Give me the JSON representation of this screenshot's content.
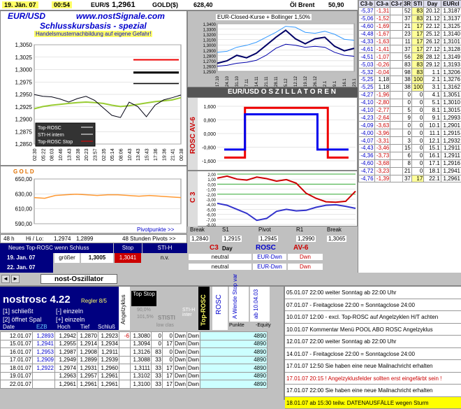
{
  "topbar": {
    "date": "19. Jän. 07",
    "time": "00:54",
    "eur_label": "EUR/$",
    "eur_value": "1,2961",
    "gold_label": "GOLD($)",
    "gold_value": "628,40",
    "oil_label": "Öl Brent",
    "oil_value": "50,90"
  },
  "left_chart": {
    "title1": "EUR/USD",
    "title2": "www.nostSignale.com",
    "subtitle": "Schlusskursbasis - spezial",
    "warning": "Handelsmusternachbildung auf eigene Gefahr!",
    "legend": [
      "Top-ROSC",
      "STI-H intern",
      "Top-ROSC Stop"
    ]
  },
  "bollinger": {
    "title": "EUR-Closed-Kurse + Bollinger 1,50%"
  },
  "oszillator": {
    "title": "EUR/USD   O S Z I L L A T O R E N",
    "rosc_label": "ROSC AV-6",
    "c3_label": "C 3"
  },
  "gold_chart": {
    "title": "G O L D",
    "pivot_label": "Pivotpunkte >>"
  },
  "pivot": {
    "labels": [
      "Break",
      "S1",
      "Pivot",
      "R1",
      "Break"
    ],
    "values": [
      "1,2840",
      "1,2915",
      "1,2945",
      "1,2990",
      "1,3065"
    ]
  },
  "hilo": {
    "h": "48 h",
    "label": "Hi / Lo:",
    "hi": "1,2974",
    "lo": "1,2899",
    "pivots": "48 Stunden Pivots >>"
  },
  "signal": {
    "header": "Neues Top-ROSC wenn Schluss",
    "stop_h": "Stop",
    "stih_h": "STI-H",
    "row1_date": "19. Jan. 07",
    "row1_cmp": "größer",
    "row1_val": "1,3005",
    "row1_stop": "1,3041",
    "row1_sti": "n.v.",
    "row2_date": "22. Jan. 07",
    "c3": "C3",
    "day": "Day",
    "rosc": "ROSC",
    "av6": "AV-6",
    "c3_r1": "neutral",
    "rosc_r1": "EUR-Dwn",
    "av6_r1": "Dwn",
    "c3_r2": "neutral",
    "rosc_r2": "EUR-Dwn",
    "av6_r2": "Dwn"
  },
  "tab": {
    "label": "nost-Oszillator"
  },
  "right_table": {
    "headers": [
      "C3-b",
      "C3-a",
      "C3-r",
      "3R",
      "STI",
      "Day",
      "EURcl"
    ],
    "rows": [
      [
        "-5,37",
        "-1,31",
        "52",
        "83",
        "20.12",
        "1,3187"
      ],
      [
        "-5,06",
        "-1,52",
        "37",
        "83",
        "21.12",
        "1,3137"
      ],
      [
        "-4,60",
        "-1,69",
        "21",
        "17",
        "22.12",
        "1,3125"
      ],
      [
        "-4,48",
        "-1,67",
        "23",
        "17",
        "25.12",
        "1,3140"
      ],
      [
        "-4,33",
        "-1,63",
        "11",
        "17",
        "26.12",
        "1,3101"
      ],
      [
        "-4,61",
        "-1,41",
        "37",
        "17",
        "27.12",
        "1,3128"
      ],
      [
        "-4,51",
        "-1,07",
        "56",
        "28",
        "28.12",
        "1,3149"
      ],
      [
        "-5,03",
        "-0,26",
        "83",
        "83",
        "29.12",
        "1,3193"
      ],
      [
        "-5,32",
        "-0,04",
        "98",
        "83",
        "1.1",
        "1,3206"
      ],
      [
        "-5,25",
        "1,18",
        "38",
        "100",
        "2.1",
        "1,3276"
      ],
      [
        "-5,25",
        "1,18",
        "38",
        "100",
        "3.1",
        "1,3162"
      ],
      [
        "-4,27",
        "-1,96",
        "0",
        "0",
        "4.1",
        "1,3051"
      ],
      [
        "-4,10",
        "-2,80",
        "0",
        "0",
        "5.1",
        "1,3010"
      ],
      [
        "-4,10",
        "-2,77",
        "5",
        "0",
        "8.1",
        "1,3015"
      ],
      [
        "-4,23",
        "-2,64",
        "9",
        "0",
        "9.1",
        "1,2993"
      ],
      [
        "-4,09",
        "-3,63",
        "0",
        "0",
        "10.1",
        "1,2901"
      ],
      [
        "-4,00",
        "-3,96",
        "0",
        "0",
        "11.1",
        "1,2915"
      ],
      [
        "-4,07",
        "-3,31",
        "3",
        "0",
        "12.1",
        "1,2932"
      ],
      [
        "-4,43",
        "-3,46",
        "15",
        "0",
        "15.1",
        "1,2911"
      ],
      [
        "-4,36",
        "-3,73",
        "6",
        "0",
        "16.1",
        "1,2911"
      ],
      [
        "-4,60",
        "-3,68",
        "8",
        "0",
        "17.1",
        "1,2916"
      ],
      [
        "-4,72",
        "-3,23",
        "21",
        "0",
        "18.1",
        "1,2941"
      ],
      [
        "-4,76",
        "-1,39",
        "37",
        "17",
        "22.1",
        "1,2961"
      ]
    ]
  },
  "bottom": {
    "title": "nostrosc 4.22",
    "regler": "Regler 8/5",
    "opt1": "[1] schließt",
    "opt1b": "[-] einzeln",
    "opt2": "[2] öffnet Spal",
    "opt2b": "[+] einzeln",
    "col_date": "Date",
    "col_ezb": "EZB",
    "col_hoch": "Hoch",
    "col_tief": "Tief",
    "col_schluss": "Schluß",
    "angel": "Angelzyklus",
    "topstop": "Top Stop",
    "sti_pct": "90,0%",
    "sti_pct2": "101,5%",
    "stist": "STISTI",
    "lowclas": "low clas",
    "stih": "STI-H inter",
    "toprosc": "Top-ROSC",
    "rosc": "ROSC",
    "awende": "A Wende Stop var",
    "ab": "ab 10.04.03",
    "punkte": "Punkte",
    "equity": "-Equity",
    "rows": [
      [
        "12.01.07",
        "1,2893",
        "1,2942",
        "1,2870",
        "1,2923",
        "-6",
        "1,3080",
        "0",
        "0",
        "Dwn",
        "Dwn",
        "4890"
      ],
      [
        "15.01.07",
        "1,2941",
        "1,2955",
        "1,2914",
        "1,2934",
        "",
        "1,3094",
        "0",
        "17",
        "Dwn",
        "Dwn",
        "4890"
      ],
      [
        "16.01.07",
        "1,2953",
        "1,2987",
        "1,2908",
        "1,2911",
        "",
        "1,3126",
        "83",
        "0",
        "Dwn",
        "Dwn",
        "4890"
      ],
      [
        "17.01.07",
        "1,2909",
        "1,2949",
        "1,2899",
        "1,2939",
        "",
        "1,3088",
        "33",
        "0",
        "Dwn",
        "Dwn",
        "4890"
      ],
      [
        "18.01.07",
        "1,2922",
        "1,2974",
        "1,2931",
        "1,2960",
        "",
        "1,3111",
        "33",
        "17",
        "Dwn",
        "Dwn",
        "4890"
      ],
      [
        "19.01.07",
        "",
        "1,2963",
        "1,2957",
        "1,2961",
        "",
        "1,3102",
        "33",
        "17",
        "Dwn",
        "Dwn",
        "4890"
      ],
      [
        "22.01.07",
        "",
        "1,2961",
        "1,2961",
        "1,2961",
        "",
        "1,3100",
        "33",
        "17",
        "Dwn",
        "Dwn",
        "4890"
      ]
    ]
  },
  "news": [
    "05.01.07 22:00 weiter Sonntag ab 22:00 Uhr",
    "07.01.07 - Freitagclose 22:00 = Sonntagclose 24:00",
    "10.01.07 12:00 - excl. Top-ROSC auf Angelzyklen H/T achten",
    "10.01.07 Kommentar Menü POOL ABO ROSC Angelzyklus",
    "12.01.07 22:00 weiter Sonntag ab 22:00 Uhr",
    "14.01.07 - Freitagclose 22:00 = Sonntagclose 24:00",
    "17.01.07 12:50 Sie haben eine neue Mailnachricht erhalten",
    "17.01.07 20:15 ! Angelzyklusfelder sollten erst eingefärbt sein !",
    "17.01.07 22:00 Sie haben eine neue Mailnachricht erhalten",
    "18.01.07 ab 15:30 teilw. DATENAUSFÄLLE wegen Sturm"
  ],
  "chart_data": [
    {
      "type": "line",
      "title": "EUR/USD",
      "ylim": [
        1.285,
        1.3075
      ],
      "yticks": [
        "1,3050",
        "1,3025",
        "1,3000",
        "1,2975",
        "1,2950",
        "1,2925",
        "1,2900",
        "1,2875",
        "1,2850"
      ],
      "x": [
        "02:30",
        "05:22",
        "08:03",
        "10:46",
        "13:43",
        "16:38",
        "20:23",
        "23:57",
        "02:35",
        "05:14",
        "08:06",
        "10:43",
        "13:43",
        "15:43",
        "17:36",
        "19:36",
        "21:41",
        "00:38"
      ],
      "series": [
        {
          "name": "Top-ROSC",
          "values": [
            1.2962,
            1.2958,
            1.2957,
            1.2952,
            1.2945,
            1.2953,
            1.2958,
            1.2949,
            1.2932,
            1.2915,
            1.291,
            1.2945,
            1.2935,
            1.2912,
            1.2938,
            1.295,
            1.2955,
            1.2961
          ]
        },
        {
          "name": "",
          "values": [
            1.293,
            1.2935,
            1.2938,
            1.294,
            1.2942,
            1.2944,
            1.2945,
            1.2944,
            1.2942,
            1.2938,
            1.2935,
            1.2937,
            1.294,
            1.2943,
            1.2946,
            1.2948,
            1.295,
            1.2955
          ]
        },
        {
          "name": "Top-ROSC Stop",
          "values": [
            1.3041,
            1.3041
          ]
        },
        {
          "name": "STI-H intern",
          "values": [
            1.3012,
            1.3012
          ]
        },
        {
          "name": "",
          "values": [
            1.2987,
            1.2987
          ]
        }
      ]
    },
    {
      "type": "line",
      "title": "EUR-Closed-Kurse + Bollinger 1,50%",
      "ylim": [
        1.25,
        1.345
      ],
      "yticks": [
        "1,3400",
        "1,3300",
        "1,3200",
        "1,3100",
        "1,3000",
        "1,2900",
        "1,2800",
        "1,2700",
        "1,2600",
        "1,2500"
      ],
      "x": [
        "17.10",
        "24.10",
        "31.10",
        "7.11",
        "14.11",
        "21.11",
        "28.11",
        "5.12",
        "12.12",
        "19.12",
        "26.12",
        "2.1",
        "9.1",
        "16.1",
        "23.1"
      ],
      "series": [
        {
          "name": "",
          "values": [
            1.266,
            1.271,
            1.282,
            1.277,
            1.286,
            1.302,
            1.318,
            1.332,
            1.315,
            1.305,
            1.315,
            1.318,
            1.3,
            1.291,
            1.296
          ]
        },
        {
          "name": "",
          "values": [
            1.288,
            1.29,
            1.298,
            1.302,
            1.308,
            1.318,
            1.328,
            1.34,
            1.338,
            1.328,
            1.326,
            1.33,
            1.324,
            1.314,
            1.312
          ]
        },
        {
          "name": "",
          "values": [
            1.26,
            1.262,
            1.266,
            1.268,
            1.272,
            1.282,
            1.296,
            1.304,
            1.302,
            1.298,
            1.3,
            1.298,
            1.288,
            1.282,
            1.28
          ]
        }
      ]
    },
    {
      "type": "line",
      "title": "ROSC AV-6",
      "ylim": [
        -1.7,
        1.7
      ],
      "yticks": [
        "1,600",
        "0,800",
        "0,000",
        "-0,800",
        "-1,600"
      ],
      "series": [
        {
          "name": "",
          "values": [
            -1.5,
            -1.5,
            1.6,
            1.6,
            1.6,
            1.6,
            1.6,
            1.6,
            1.6,
            1.6,
            -1.5,
            -1.5,
            -1.5
          ]
        },
        {
          "name": "",
          "values": [
            -1.0,
            -1.0,
            1.2,
            1.2,
            1.2,
            1.2,
            1.2,
            1.2,
            1.2,
            -1.0,
            -1.0,
            -1.0,
            -1.0
          ]
        }
      ]
    },
    {
      "type": "line",
      "title": "C 3",
      "ylim": [
        -8,
        2
      ],
      "yticks": [
        "2,00",
        "1,00",
        "0,00",
        "-1,00",
        "-2,00",
        "-3,00",
        "-4,00",
        "-5,00",
        "-6,00",
        "-7,00",
        "-8,00"
      ],
      "series": [
        {
          "name": "",
          "values": [
            1.2,
            1.6,
            1.0,
            0.8,
            1.4,
            1.1,
            0.6,
            0.9,
            0.2,
            -1.8,
            -2.8,
            -3.5,
            -3.6,
            -3.4,
            -1.4
          ]
        },
        {
          "name": "",
          "values": [
            -3.8,
            -4.2,
            -5.0,
            -5.8,
            -7.2,
            -6.8,
            -5.4,
            -5.0,
            -5.3,
            -5.2,
            -4.6,
            -4.2,
            -4.1,
            -4.4,
            -4.8
          ]
        }
      ]
    },
    {
      "type": "line",
      "title": "G O L D",
      "ylim": [
        590,
        655
      ],
      "yticks": [
        "650,00",
        "630,00",
        "610,00",
        "590,00"
      ],
      "series": [
        {
          "name": "",
          "values": [
            628,
            627,
            631,
            632,
            633,
            632,
            631,
            632,
            632,
            631,
            630,
            631,
            630,
            629,
            628
          ]
        }
      ]
    }
  ]
}
